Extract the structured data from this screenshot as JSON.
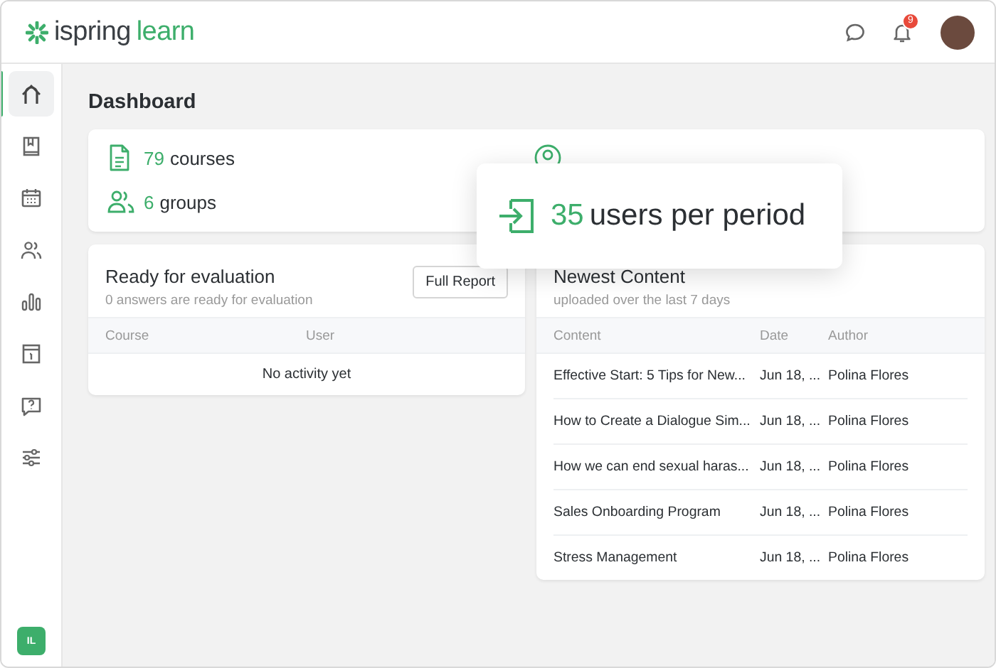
{
  "header": {
    "logo": {
      "brand": "ispring",
      "product": "learn"
    },
    "notification_count": "9"
  },
  "sidebar": {
    "items": [
      {
        "selected": true
      },
      {
        "selected": false
      },
      {
        "selected": false
      },
      {
        "selected": false
      },
      {
        "selected": false
      },
      {
        "selected": false
      },
      {
        "selected": false
      },
      {
        "selected": false
      }
    ],
    "user_initials": "IL"
  },
  "page_title": "Dashboard",
  "stats": [
    {
      "value": "79",
      "label": "courses"
    },
    {
      "value": "6",
      "label": "groups"
    }
  ],
  "popup": {
    "value": "35",
    "label": "users per period"
  },
  "evaluation": {
    "title": "Ready for evaluation",
    "subtitle": "0 answers are ready for evaluation",
    "button": "Full Report",
    "columns": [
      "Course",
      "User"
    ],
    "empty": "No activity yet"
  },
  "newest_content": {
    "title": "Newest Content",
    "subtitle": "uploaded over the last 7 days",
    "columns": [
      "Content",
      "Date",
      "Author"
    ],
    "rows": [
      {
        "content": "Effective Start: 5 Tips for New...",
        "date": "Jun 18, ...",
        "author": "Polina Flores"
      },
      {
        "content": "How to Create a Dialogue Sim...",
        "date": "Jun 18, ...",
        "author": "Polina Flores"
      },
      {
        "content": "How we can end sexual haras...",
        "date": "Jun 18, ...",
        "author": "Polina Flores"
      },
      {
        "content": "Sales Onboarding Program",
        "date": "Jun 18, ...",
        "author": "Polina Flores"
      },
      {
        "content": "Stress Management",
        "date": "Jun 18, ...",
        "author": "Polina Flores"
      }
    ]
  }
}
